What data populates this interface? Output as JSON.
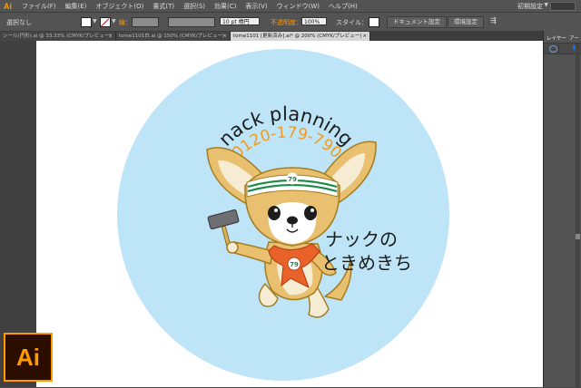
{
  "app": {
    "logo": "Ai"
  },
  "menubar": {
    "items": [
      "ファイル(F)",
      "編集(E)",
      "オブジェクト(O)",
      "書式(T)",
      "選択(S)",
      "効果(C)",
      "表示(V)",
      "ウィンドウ(W)",
      "ヘルプ(H)"
    ],
    "workspace": "初期設定"
  },
  "control_bar": {
    "selection": "選択なし",
    "stroke_label": "線：",
    "brush_size": "10 pt 楕円",
    "opacity_label": "不透明度：",
    "opacity_value": "100%",
    "style_label": "スタイル：",
    "document_setup": "ドキュメント設定",
    "preferences": "環境設定"
  },
  "tabs": [
    "シール(円形).ai @ 33.33% (CMYK/プレビュー)",
    "tome1101白.ai @ 150% (CMYK/プレビュー)",
    "tome1101 [更新済み].ai* @ 200% (CMYK/プレビュー)"
  ],
  "right_panel": {
    "tab_layers": "レイヤー",
    "tab_artboards": "アートボ"
  },
  "artwork": {
    "company": "nack planning",
    "phone": "0120-179-790",
    "headband_badge": "79",
    "scarf_badge": "79",
    "slogan_line1": "ナックの",
    "slogan_line2": "ときめきち"
  },
  "colors": {
    "circle": "#bde4f7",
    "dog_fur": "#e9c070",
    "dog_outline": "#a57d22",
    "headband_stripe": "#1e8a4a",
    "scarf": "#e8622a",
    "phone_text": "#f29b1e",
    "app_accent": "#ff9a00"
  }
}
